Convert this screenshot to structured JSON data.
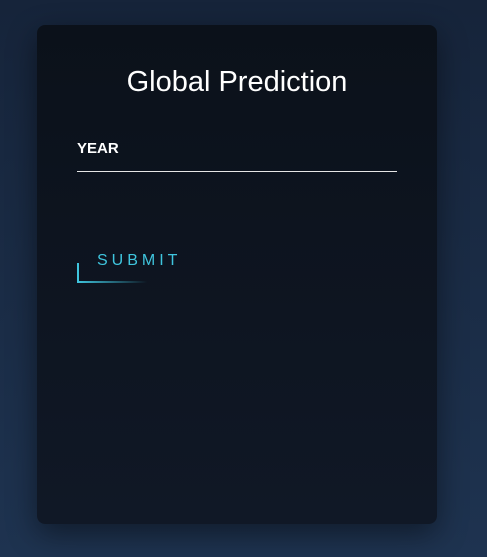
{
  "form": {
    "title": "Global Prediction",
    "year_label": "YEAR",
    "year_value": "",
    "submit_label": "SUBMIT"
  },
  "colors": {
    "accent": "#3fc5de",
    "card_background": "#0b111a",
    "page_background": "#1a2b44"
  }
}
